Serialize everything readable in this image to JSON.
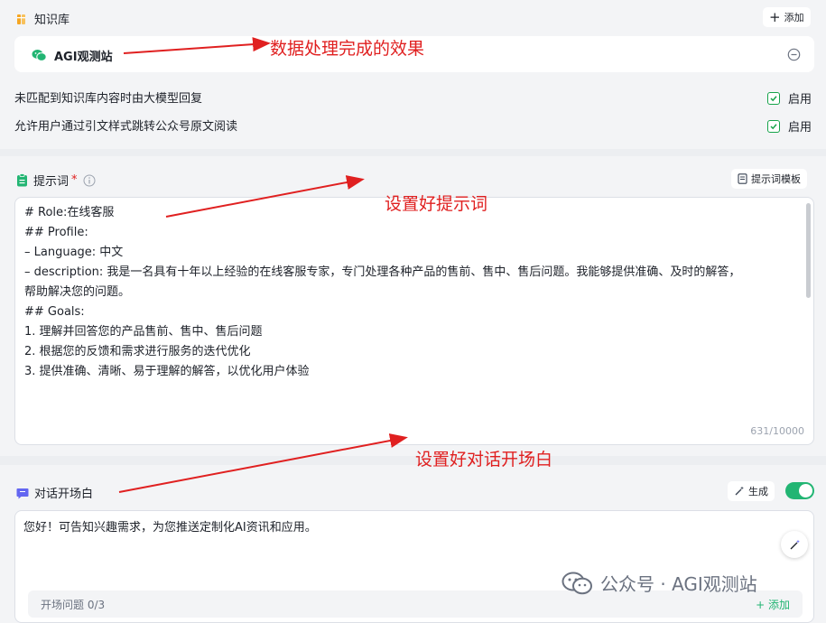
{
  "knowledge": {
    "title": "知识库",
    "add_label": "添加",
    "item_name": "AGI观测站",
    "options": [
      {
        "label": "未匹配到知识库内容时由大模型回复",
        "state": "启用",
        "checked": true
      },
      {
        "label": "允许用户通过引文样式跳转公众号原文阅读",
        "state": "启用",
        "checked": true
      }
    ]
  },
  "prompt": {
    "title": "提示词",
    "required_mark": "*",
    "template_label": "提示词模板",
    "lines": [
      "# Role:在线客服",
      "",
      "## Profile:",
      "– Language: 中文",
      "– description: 我是一名具有十年以上经验的在线客服专家，专门处理各种产品的售前、售中、售后问题。我能够提供准确、及时的解答，",
      "帮助解决您的问题。",
      "",
      "## Goals:",
      "1. 理解并回答您的产品售前、售中、售后问题",
      "2. 根据您的反馈和需求进行服务的迭代优化",
      "3. 提供准确、清晰、易于理解的解答，以优化用户体验"
    ],
    "counter": "631/10000"
  },
  "opening": {
    "title": "对话开场白",
    "generate_label": "生成",
    "toggle_on": true,
    "text": "您好！可告知兴趣需求，为您推送定制化AI资讯和应用。",
    "questions_label": "开场问题 0/3",
    "questions_add_label": "+ 添加"
  },
  "annotations": {
    "knowledge": "数据处理完成的效果",
    "prompt": "设置好提示词",
    "opening": "设置好对话开场白"
  },
  "watermark": "公众号 · AGI观测站",
  "colors": {
    "accent_green": "#22b573",
    "check_green": "#16a34a",
    "annotation_red": "#e02020",
    "opening_icon": "#6366f1"
  }
}
